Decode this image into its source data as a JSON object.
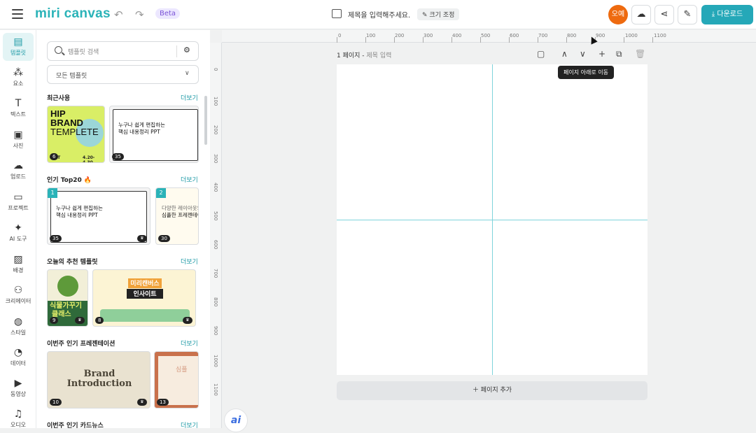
{
  "topbar": {
    "logo": "miri canvas",
    "beta": "Beta",
    "doc_title_placeholder": "제목을 입력해주세요.",
    "resize_label": "✎ 크기 조정",
    "user_initials": "오예",
    "download_label": "⤓ 다운로드"
  },
  "nav": [
    {
      "label": "템플릿",
      "icon": "▤"
    },
    {
      "label": "요소",
      "icon": "⁂"
    },
    {
      "label": "텍스트",
      "icon": "T"
    },
    {
      "label": "사진",
      "icon": "▣"
    },
    {
      "label": "업로드",
      "icon": "☁"
    },
    {
      "label": "프로젝트",
      "icon": "▭"
    },
    {
      "label": "AI 도구",
      "icon": "✦"
    },
    {
      "label": "배경",
      "icon": "▨"
    },
    {
      "label": "크리에이터",
      "icon": "⚇"
    },
    {
      "label": "스타일",
      "icon": "◍"
    },
    {
      "label": "데이터",
      "icon": "◔"
    },
    {
      "label": "동영상",
      "icon": "▶"
    },
    {
      "label": "오디오",
      "icon": "♫"
    }
  ],
  "panel": {
    "search_placeholder": "템플릿 검색",
    "category_select": "모든 템플릿",
    "more_label": "더보기",
    "sections": [
      "최근사용",
      "인기 Top20 🔥",
      "오늘의 추천 템플릿",
      "이번주 인기 프레젠테이션",
      "이번주 인기 카드뉴스"
    ]
  },
  "thumbs": {
    "hip": {
      "line1": "HIP",
      "line2": "BRAND",
      "line3": "TEMPLETE",
      "footer_left": "ENT",
      "footer_right": "4.20-4.30",
      "badge": "6"
    },
    "ppt_recent": {
      "line1": "누구나 쉽게 편집하는",
      "line2": "핵심 내용정리 PPT",
      "badge": "35"
    },
    "top1": {
      "rank": "1",
      "line1": "누구나 쉽게 편집하는",
      "line2": "핵심 내용정리 PPT",
      "badge": "35"
    },
    "top2": {
      "rank": "2",
      "line1": "다양한 레이아웃의",
      "line2": "심플한 프레젠테이션",
      "badge": "30"
    },
    "rec1": {
      "line1": "식물가꾸기",
      "line2": "클래스",
      "badge": "9"
    },
    "rec2": {
      "line1": "미리캔버스",
      "line2": "인사이트",
      "badge": "8"
    },
    "brand": {
      "line1": "Brand",
      "line2": "Introduction",
      "badge": "10"
    },
    "red": {
      "line1": "심플",
      "badge": "13"
    }
  },
  "ruler": {
    "h_labels": [
      "0",
      "100",
      "200",
      "300",
      "400",
      "500",
      "600",
      "700",
      "800",
      "900",
      "1000",
      "1100"
    ],
    "v_labels": [
      "0",
      "100",
      "200",
      "300",
      "400",
      "500",
      "600",
      "700",
      "800",
      "900",
      "1000",
      "1100"
    ]
  },
  "page": {
    "number_label": "1 페이지 - ",
    "title_placeholder": "제목 입력"
  },
  "tooltip": "페이지 아래로 이동",
  "add_page_label": "＋ 페이지 추가",
  "ai_button": "ai",
  "colors": {
    "accent": "#25a8b8",
    "avatar": "#ee6a0f",
    "guide": "#7fd3db"
  }
}
